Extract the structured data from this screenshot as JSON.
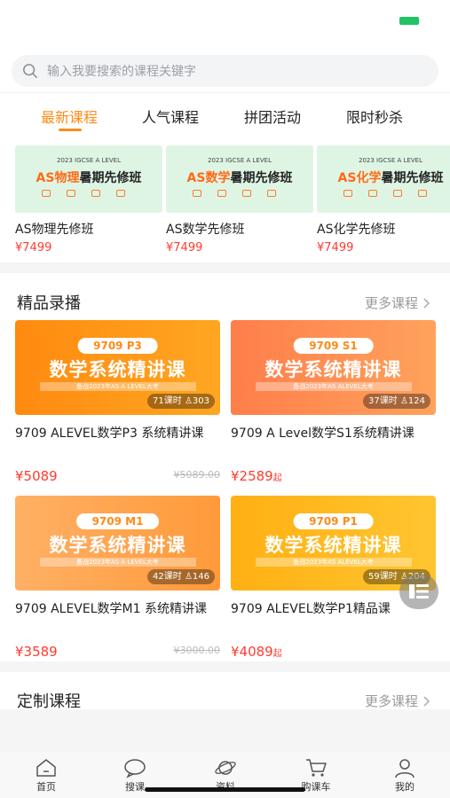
{
  "search": {
    "placeholder": "输入我要搜索的课程关键字"
  },
  "tabs": [
    {
      "label": "最新课程",
      "active": true
    },
    {
      "label": "人气课程",
      "active": false
    },
    {
      "label": "拼团活动",
      "active": false
    },
    {
      "label": "限时秒杀",
      "active": false
    }
  ],
  "featured": [
    {
      "banner_sub": "2023 IGCSE A LEVEL",
      "banner_accent": "AS物理",
      "banner_rest": "暑期先修班",
      "title": "AS物理先修班",
      "price": "¥7499"
    },
    {
      "banner_sub": "2023 IGCSE A LEVEL",
      "banner_accent": "AS数学",
      "banner_rest": "暑期先修班",
      "title": "AS数学先修班",
      "price": "¥7499"
    },
    {
      "banner_sub": "2023 IGCSE A LEVEL",
      "banner_accent": "AS化学",
      "banner_rest": "暑期先修班",
      "title": "AS化学先修班",
      "price": "¥7499"
    }
  ],
  "recorded": {
    "title": "精品录播",
    "more": "更多课程",
    "courses": [
      {
        "code": "9709 P3",
        "banner": "数学系统精讲课",
        "bar": "备战2023年AS A LEVEL大考",
        "lessons": "71课时",
        "students": "303",
        "title": "9709 ALEVEL数学P3 系统精讲课",
        "price": "¥5089",
        "price_suffix": "",
        "original": "¥5089.00"
      },
      {
        "code": "9709 S1",
        "banner": "数学系统精讲课",
        "bar": "备战2023年AS ALEVEL大考",
        "lessons": "37课时",
        "students": "124",
        "title": "9709 A Level数学S1系统精讲课",
        "price": "¥2589",
        "price_suffix": "起",
        "original": ""
      },
      {
        "code": "9709 M1",
        "banner": "数学系统精讲课",
        "bar": "备战2023年AS A LEVEL大考",
        "lessons": "42课时",
        "students": "146",
        "title": "9709 ALEVEL数学M1 系统精讲课",
        "price": "¥3589",
        "price_suffix": "",
        "original": "¥3000.00"
      },
      {
        "code": "9709 P1",
        "banner": "数学系统精讲课",
        "bar": "备战2023年AS ALEVEL大考",
        "lessons": "59课时",
        "students": "204",
        "title": "9709 ALEVEL数学P1精品课",
        "price": "¥4089",
        "price_suffix": "起",
        "original": ""
      }
    ]
  },
  "custom": {
    "title": "定制课程",
    "more": "更多课程"
  },
  "nav": [
    {
      "label": "首页",
      "icon": "home-icon"
    },
    {
      "label": "搜课",
      "icon": "chat-bubble-icon"
    },
    {
      "label": "资料",
      "icon": "planet-icon"
    },
    {
      "label": "购课车",
      "icon": "cart-icon"
    },
    {
      "label": "我的",
      "icon": "user-icon"
    }
  ],
  "colors": {
    "accent": "#ff8b17",
    "price": "#ff3b30",
    "status_battery": "#20c463"
  }
}
